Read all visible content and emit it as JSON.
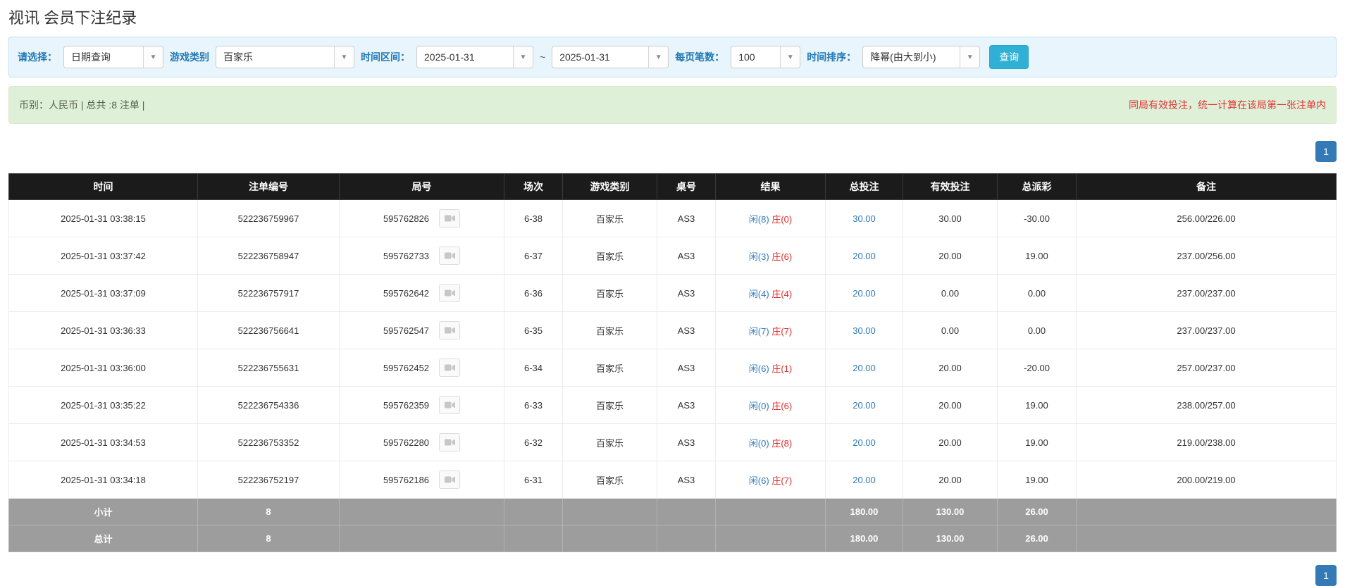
{
  "page_title": "视讯 会员下注纪录",
  "filters": {
    "select_label": "请选择：",
    "select_value": "日期查询",
    "game_type_label": "游戏类别",
    "game_type_value": "百家乐",
    "time_range_label": "时间区间：",
    "time_from": "2025-01-31",
    "tilde": "~",
    "time_to": "2025-01-31",
    "page_size_label": "每页笔数：",
    "page_size_value": "100",
    "sort_label": "时间排序：",
    "sort_value": "降幂(由大到小)",
    "search_button_label": "查询",
    "dropdown_arrow": "▼"
  },
  "notice": {
    "left_text": "币别：人民币 | 总共 :8 注单 |",
    "right_text": "同局有效投注，统一计算在该局第一张注单内"
  },
  "pagination": {
    "current_page": "1"
  },
  "table": {
    "headers": [
      "时间",
      "注单编号",
      "局号",
      "场次",
      "游戏类别",
      "桌号",
      "结果",
      "总投注",
      "有效投注",
      "总派彩",
      "备注"
    ],
    "rows": [
      {
        "time": "2025-01-31 03:38:15",
        "bet_id": "522236759967",
        "round_id": "595762826",
        "session": "6-38",
        "game_type": "百家乐",
        "table_no": "AS3",
        "result_player": "闲(8)",
        "result_banker": "庄(0)",
        "total_bet": "30.00",
        "valid_bet": "30.00",
        "payout": "-30.00",
        "remark": "256.00/226.00"
      },
      {
        "time": "2025-01-31 03:37:42",
        "bet_id": "522236758947",
        "round_id": "595762733",
        "session": "6-37",
        "game_type": "百家乐",
        "table_no": "AS3",
        "result_player": "闲(3)",
        "result_banker": "庄(6)",
        "total_bet": "20.00",
        "valid_bet": "20.00",
        "payout": "19.00",
        "remark": "237.00/256.00"
      },
      {
        "time": "2025-01-31 03:37:09",
        "bet_id": "522236757917",
        "round_id": "595762642",
        "session": "6-36",
        "game_type": "百家乐",
        "table_no": "AS3",
        "result_player": "闲(4)",
        "result_banker": "庄(4)",
        "total_bet": "20.00",
        "valid_bet": "0.00",
        "payout": "0.00",
        "remark": "237.00/237.00"
      },
      {
        "time": "2025-01-31 03:36:33",
        "bet_id": "522236756641",
        "round_id": "595762547",
        "session": "6-35",
        "game_type": "百家乐",
        "table_no": "AS3",
        "result_player": "闲(7)",
        "result_banker": "庄(7)",
        "total_bet": "30.00",
        "valid_bet": "0.00",
        "payout": "0.00",
        "remark": "237.00/237.00"
      },
      {
        "time": "2025-01-31 03:36:00",
        "bet_id": "522236755631",
        "round_id": "595762452",
        "session": "6-34",
        "game_type": "百家乐",
        "table_no": "AS3",
        "result_player": "闲(6)",
        "result_banker": "庄(1)",
        "total_bet": "20.00",
        "valid_bet": "20.00",
        "payout": "-20.00",
        "remark": "257.00/237.00"
      },
      {
        "time": "2025-01-31 03:35:22",
        "bet_id": "522236754336",
        "round_id": "595762359",
        "session": "6-33",
        "game_type": "百家乐",
        "table_no": "AS3",
        "result_player": "闲(0)",
        "result_banker": "庄(6)",
        "total_bet": "20.00",
        "valid_bet": "20.00",
        "payout": "19.00",
        "remark": "238.00/257.00"
      },
      {
        "time": "2025-01-31 03:34:53",
        "bet_id": "522236753352",
        "round_id": "595762280",
        "session": "6-32",
        "game_type": "百家乐",
        "table_no": "AS3",
        "result_player": "闲(0)",
        "result_banker": "庄(8)",
        "total_bet": "20.00",
        "valid_bet": "20.00",
        "payout": "19.00",
        "remark": "219.00/238.00"
      },
      {
        "time": "2025-01-31 03:34:18",
        "bet_id": "522236752197",
        "round_id": "595762186",
        "session": "6-31",
        "game_type": "百家乐",
        "table_no": "AS3",
        "result_player": "闲(6)",
        "result_banker": "庄(7)",
        "total_bet": "20.00",
        "valid_bet": "20.00",
        "payout": "19.00",
        "remark": "200.00/219.00"
      }
    ],
    "subtotal_row": {
      "label": "小计",
      "count": "8",
      "total_bet": "180.00",
      "valid_bet": "130.00",
      "payout": "26.00"
    },
    "total_row": {
      "label": "总计",
      "count": "8",
      "total_bet": "180.00",
      "valid_bet": "130.00",
      "payout": "26.00"
    }
  },
  "colors": {
    "accent_blue": "#337ab7",
    "player_blue": "#337ab7",
    "banker_red": "#e02b2b",
    "negative_red": "#e02b2b",
    "search_button_bg": "#31b0d5",
    "table_header_bg": "#1b1b1b",
    "footer_row_bg": "#9d9d9d",
    "filter_bar_bg": "#e9f5fc",
    "notice_bar_bg": "#dff0d8"
  },
  "icons": {
    "replay_icon": "video-camera-icon"
  }
}
